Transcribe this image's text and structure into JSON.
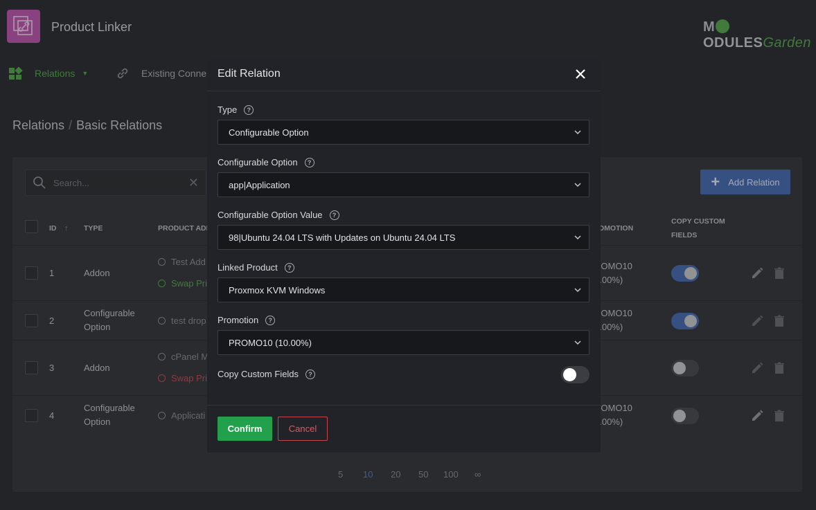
{
  "app": {
    "title": "Product Linker",
    "brand_m": "M",
    "brand_odules": "ODULES",
    "brand_garden": "Garden"
  },
  "nav": {
    "relations": "Relations",
    "existing": "Existing Conne"
  },
  "breadcrumb": {
    "root": "Relations",
    "sep": "/",
    "current": "Basic Relations"
  },
  "table": {
    "search_placeholder": "Search...",
    "add_button": "Add Relation",
    "headers": {
      "id": "ID",
      "sort": "↑",
      "type": "TYPE",
      "product_addon": "PRODUCT ADD",
      "promotion": "OMOTION",
      "copy1": "COPY CUSTOM",
      "copy2": "FIELDS"
    },
    "rows": [
      {
        "id": "1",
        "type1": "Addon",
        "type2": "",
        "addon1": "Test Add",
        "addon2": "Swap Pri",
        "promo1": "ROMO10",
        "promo2": "0.00%)",
        "copy": true
      },
      {
        "id": "2",
        "type1": "Configurable",
        "type2": "Option",
        "addon1": "test drop",
        "addon2": "",
        "promo1": "ROMO10",
        "promo2": "0.00%)",
        "copy": true
      },
      {
        "id": "3",
        "type1": "Addon",
        "type2": "",
        "addon1": "cPanel M",
        "addon2": "Swap Pri",
        "promo1": "",
        "promo2": "",
        "copy": false
      },
      {
        "id": "4",
        "type1": "Configurable",
        "type2": "Option",
        "addon1": "Applicati",
        "addon2": "",
        "promo1": "ROMO10",
        "promo2": "0.00%)",
        "copy": false
      }
    ],
    "page_sizes": [
      "5",
      "10",
      "20",
      "50",
      "100",
      "∞"
    ],
    "active_page_size": "10"
  },
  "modal": {
    "title": "Edit Relation",
    "help_glyph": "?",
    "fields": {
      "type": {
        "label": "Type",
        "value": "Configurable Option"
      },
      "config_option": {
        "label": "Configurable Option",
        "value": "app|Application"
      },
      "config_value": {
        "label": "Configurable Option Value",
        "value": "98|Ubuntu 24.04 LTS with Updates on Ubuntu 24.04 LTS"
      },
      "linked_product": {
        "label": "Linked Product",
        "value": "Proxmox KVM Windows"
      },
      "promotion": {
        "label": "Promotion",
        "value": "PROMO10 (10.00%)"
      },
      "copy_fields": {
        "label": "Copy Custom Fields",
        "enabled": false
      }
    },
    "confirm": "Confirm",
    "cancel": "Cancel"
  },
  "colors": {
    "accent_green": "#5aa952",
    "accent_blue": "#4a6fb3",
    "danger": "#c0484d",
    "confirm": "#22a04b"
  }
}
